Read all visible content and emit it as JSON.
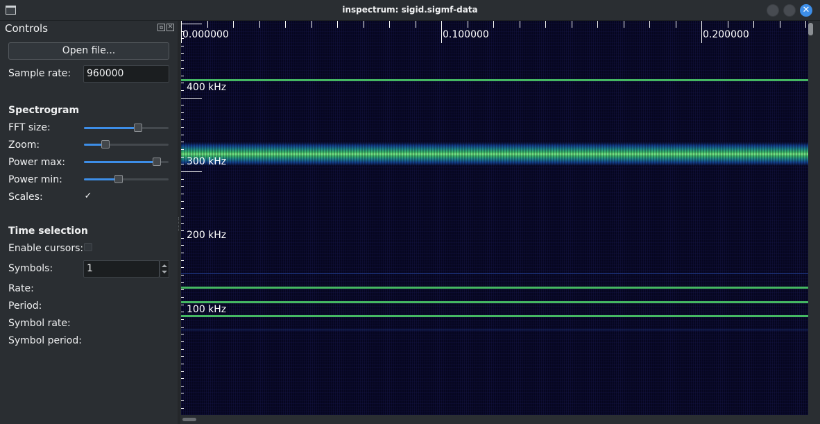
{
  "window": {
    "title": "inspectrum: sigid.sigmf-data",
    "close_glyph": "✕"
  },
  "controls": {
    "title": "Controls",
    "dock_float_glyph": "⧉",
    "dock_close_glyph": "✕",
    "open_file": "Open file...",
    "sample_rate_label": "Sample rate:",
    "sample_rate_value": "960000",
    "spectrogram_title": "Spectrogram",
    "fft_size_label": "FFT size:",
    "zoom_label": "Zoom:",
    "power_max_label": "Power max:",
    "power_min_label": "Power min:",
    "scales_label": "Scales:",
    "scales_check": "✓",
    "time_selection_title": "Time selection",
    "enable_cursors_label": "Enable cursors:",
    "symbols_label": "Symbols:",
    "symbols_value": "1",
    "rate_label": "Rate:",
    "period_label": "Period:",
    "symbol_rate_label": "Symbol rate:",
    "symbol_period_label": "Symbol period:",
    "sliders": {
      "fft_size": 0.65,
      "zoom": 0.23,
      "power_max": 0.9,
      "power_min": 0.4
    },
    "scales_checked": true,
    "cursors_checked": false
  },
  "plot": {
    "x_labels": [
      "0.000000",
      "0.100000",
      "0.200000"
    ],
    "y_labels": [
      "400 kHz",
      "300 kHz",
      "200 kHz",
      "100 kHz"
    ],
    "colors": {
      "background": "#06061f",
      "tone": "#45b862",
      "axis": "#ffffff"
    }
  }
}
